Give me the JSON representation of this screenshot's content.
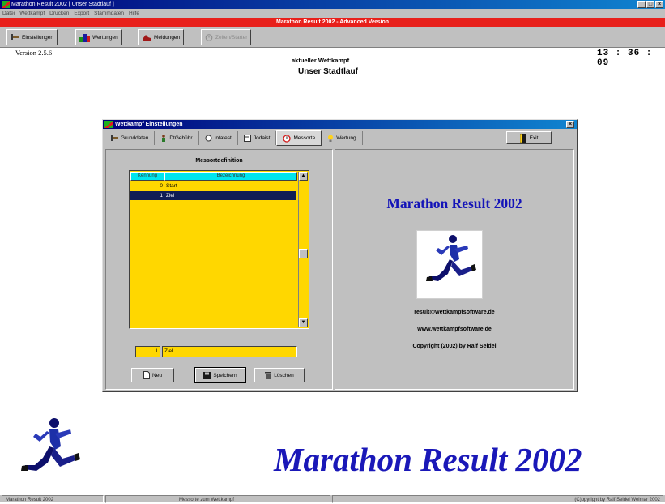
{
  "window": {
    "title": "Marathon Result 2002 [ Unser Stadtlauf ]",
    "min_label": "_",
    "max_label": "□",
    "close_label": "×"
  },
  "menu": [
    "Datei",
    "Wettkampf",
    "Drucken",
    "Export",
    "Stammdaten",
    "Hilfe"
  ],
  "banner": "Marathon Result 2002 - Advanced Version",
  "toolbar": {
    "settings_label": "Einstellungen",
    "ratings_label": "Wertungen",
    "registrations_label": "Meldungen",
    "timing_label": "Zeiten/Starter"
  },
  "version": "Version 2.5.6",
  "current": {
    "label": "aktueller Wettkampf",
    "name": "Unser Stadtlauf"
  },
  "clock": "13 : 36 : 09",
  "dialog": {
    "title": "Wettkampf Einstellungen",
    "close_label": "×",
    "tabs": [
      {
        "label": "Grunddaten",
        "icon": "wrench-icon"
      },
      {
        "label": "DtGebühr",
        "icon": "person-icon"
      },
      {
        "label": "Intatest",
        "icon": "circle-icon"
      },
      {
        "label": "Jodaist",
        "icon": "list-icon"
      },
      {
        "label": "Messorte",
        "icon": "stopwatch-icon"
      },
      {
        "label": "Wertung",
        "icon": "bulb-icon"
      }
    ],
    "exit_label": "Exit",
    "messort_title": "Messortdefinition",
    "grid": {
      "columns": [
        "Kennung",
        "Bezeichnung"
      ],
      "rows": [
        {
          "id": "0",
          "name": "Start"
        },
        {
          "id": "1",
          "name": "Ziel"
        }
      ],
      "selected_row": 1
    },
    "edit_id": "1",
    "edit_name": "Ziel",
    "buttons": {
      "new_label": "Neu",
      "save_label": "Speichern",
      "delete_label": "Löschen"
    },
    "product_title": "Marathon Result 2002",
    "email": "result@wettkampfsoftware.de",
    "website": "www.wettkampfsoftware.de",
    "copyright": "Copyright (2002) by Ralf Seidel"
  },
  "brand_title": "Marathon Result 2002",
  "status": {
    "left": "Marathon Result 2002",
    "middle": "Messorte zum Wettkampf",
    "right": "(C)opyright by Ralf Seidel Weimar 2002"
  },
  "colors": {
    "titlebar": "#00007b",
    "banner": "#e8201b",
    "grid_bg": "#ffd700",
    "grid_header": "#00e5ee",
    "selected_row": "#101d55",
    "brand_blue": "#1a18b8"
  }
}
